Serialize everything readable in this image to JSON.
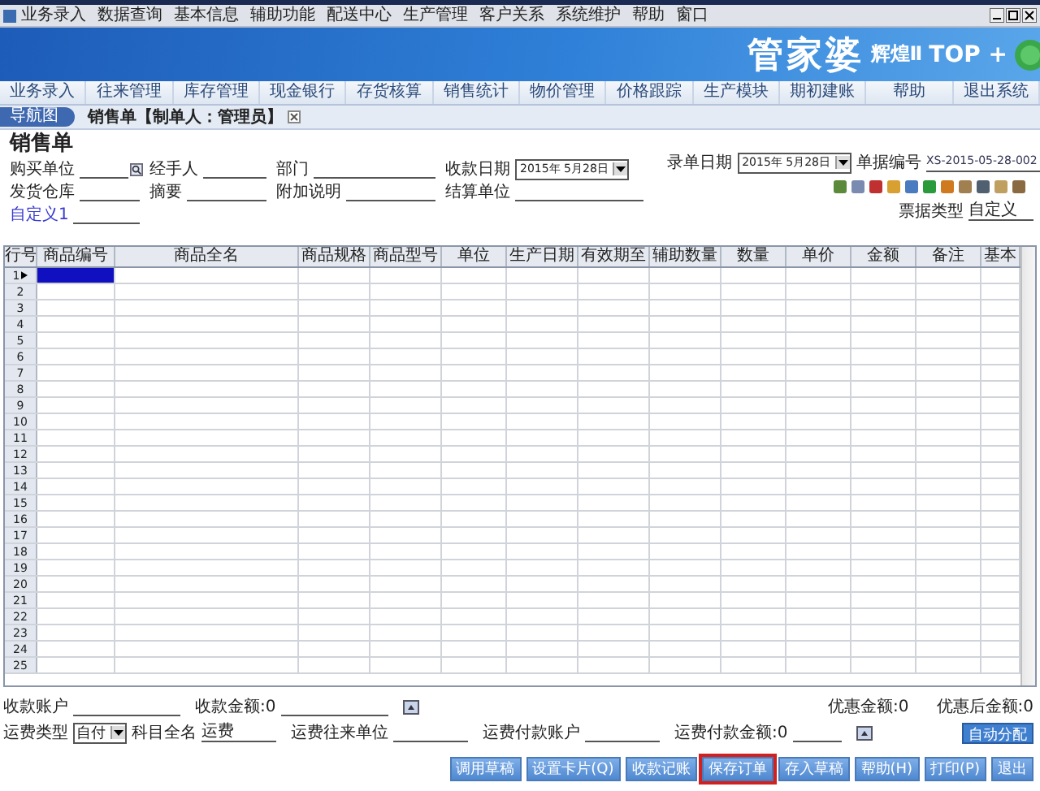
{
  "menu": [
    "业务录入",
    "数据查询",
    "基本信息",
    "辅助功能",
    "配送中心",
    "生产管理",
    "客户关系",
    "系统维护",
    "帮助",
    "窗口"
  ],
  "logo": {
    "brand": "管家婆",
    "edition": "辉煌Ⅱ",
    "suffix": "TOP +"
  },
  "nav_tabs": [
    "业务录入",
    "往来管理",
    "库存管理",
    "现金银行",
    "存货核算",
    "销售统计",
    "物价管理",
    "价格跟踪",
    "生产模块",
    "期初建账",
    "帮助",
    "退出系统"
  ],
  "breadcrumb": {
    "home_tab": "导航图",
    "document_tab": "销售单【制单人：管理员】"
  },
  "form": {
    "title": "销售单",
    "rows": [
      {
        "fields": [
          {
            "label": "购买单位",
            "kind": "lookup"
          },
          {
            "label": "经手人",
            "kind": "text"
          },
          {
            "label": "部门",
            "kind": "text"
          },
          {
            "label": "收款日期",
            "kind": "date",
            "value": "2015年 5月28日"
          }
        ]
      },
      {
        "fields": [
          {
            "label": "发货仓库",
            "kind": "text"
          },
          {
            "label": "摘要",
            "kind": "text"
          },
          {
            "label": "附加说明",
            "kind": "text"
          },
          {
            "label": "结算单位",
            "kind": "text"
          }
        ]
      },
      {
        "fields": [
          {
            "label": "自定义1",
            "kind": "link"
          }
        ]
      }
    ],
    "entry_date": {
      "label": "录单日期",
      "value": "2015年 5月28日"
    },
    "doc_number": {
      "label": "单据编号",
      "value": "XS-2015-05-28-002"
    },
    "doc_type": {
      "label": "票据类型",
      "value": "自定义"
    }
  },
  "table": {
    "columns": [
      "行号",
      "商品编号",
      "商品全名",
      "商品规格",
      "商品型号",
      "单位",
      "生产日期",
      "有效期至",
      "辅助数量",
      "数量",
      "单价",
      "金额",
      "备注",
      "基本"
    ],
    "rows": [
      {
        "row_number": "1",
        "selected": true
      },
      {
        "row_number": "2",
        "selected": false
      },
      {
        "row_number": "3",
        "selected": false
      },
      {
        "row_number": "4",
        "selected": false
      },
      {
        "row_number": "5",
        "selected": false
      },
      {
        "row_number": "6",
        "selected": false
      },
      {
        "row_number": "7",
        "selected": false
      },
      {
        "row_number": "8",
        "selected": false
      },
      {
        "row_number": "9",
        "selected": false
      },
      {
        "row_number": "10",
        "selected": false
      },
      {
        "row_number": "11",
        "selected": false
      },
      {
        "row_number": "12",
        "selected": false
      },
      {
        "row_number": "13",
        "selected": false
      },
      {
        "row_number": "14",
        "selected": false
      },
      {
        "row_number": "15",
        "selected": false
      },
      {
        "row_number": "16",
        "selected": false
      },
      {
        "row_number": "17",
        "selected": false
      },
      {
        "row_number": "18",
        "selected": false
      },
      {
        "row_number": "19",
        "selected": false
      },
      {
        "row_number": "20",
        "selected": false
      },
      {
        "row_number": "21",
        "selected": false
      },
      {
        "row_number": "22",
        "selected": false
      },
      {
        "row_number": "23",
        "selected": false
      },
      {
        "row_number": "24",
        "selected": false
      },
      {
        "row_number": "25",
        "selected": false
      }
    ]
  },
  "footer": {
    "receipt_account": "收款账户",
    "receipt_amount": "收款金额:0",
    "discount": "优惠金额:0",
    "after_discount": "优惠后金额:0",
    "freight_type": {
      "label": "运费类型",
      "value": "自付"
    },
    "subject": {
      "label": "科目全名",
      "value": "运费"
    },
    "freight_unit": "运费往来单位",
    "freight_account": "运费付款账户",
    "freight_amount": "运费付款金额:0",
    "auto_button": "自动分配"
  },
  "buttons": [
    {
      "label": "调用草稿",
      "highlighted": false
    },
    {
      "label": "设置卡片(Q)",
      "highlighted": false
    },
    {
      "label": "收款记账",
      "highlighted": false
    },
    {
      "label": "保存订单",
      "highlighted": true
    },
    {
      "label": "存入草稿",
      "highlighted": false
    },
    {
      "label": "帮助(H)",
      "highlighted": false
    },
    {
      "label": "打印(P)",
      "highlighted": false
    },
    {
      "label": "退出",
      "highlighted": false
    }
  ]
}
